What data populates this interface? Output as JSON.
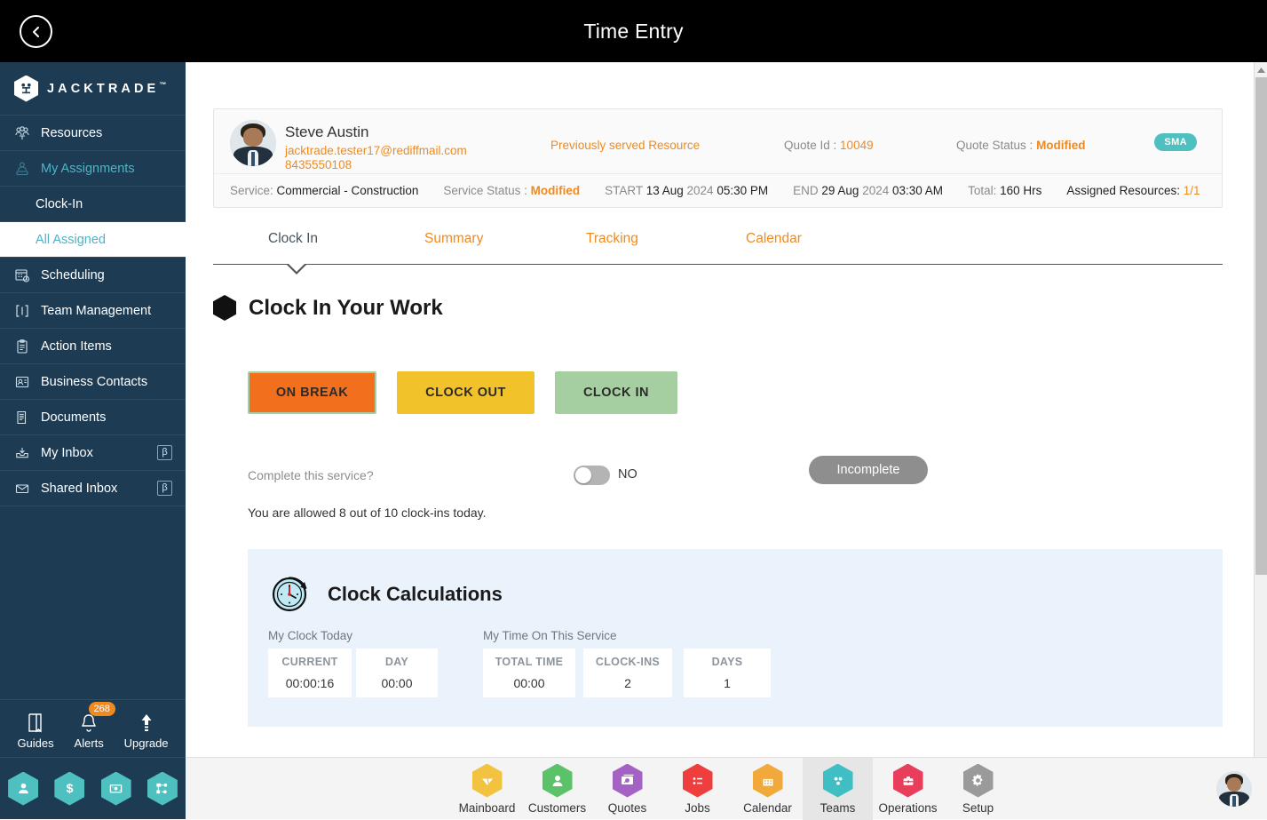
{
  "topbar": {
    "title": "Time Entry",
    "back_icon": "chevron-left-icon"
  },
  "sidebar": {
    "brand": "JACKTRADE",
    "brand_tm": "™",
    "items": [
      {
        "label": "Resources",
        "icon": "people-group-icon",
        "accent": false,
        "sub": false,
        "beta": null
      },
      {
        "label": "My Assignments",
        "icon": "assignment-person-icon",
        "accent": true,
        "sub": false,
        "beta": null
      },
      {
        "label": "Clock-In",
        "icon": null,
        "accent": false,
        "sub": true,
        "beta": null
      },
      {
        "label": "All Assigned",
        "icon": null,
        "accent": true,
        "sub": true,
        "active": true,
        "beta": null
      },
      {
        "label": "Scheduling",
        "icon": "calendar-clock-icon",
        "accent": false,
        "sub": false,
        "beta": null
      },
      {
        "label": "Team Management",
        "icon": "brackets-icon",
        "accent": false,
        "sub": false,
        "beta": null
      },
      {
        "label": "Action Items",
        "icon": "clipboard-list-icon",
        "accent": false,
        "sub": false,
        "beta": null
      },
      {
        "label": "Business Contacts",
        "icon": "contact-card-icon",
        "accent": false,
        "sub": false,
        "beta": null
      },
      {
        "label": "Documents",
        "icon": "document-icon",
        "accent": false,
        "sub": false,
        "beta": null
      },
      {
        "label": "My Inbox",
        "icon": "inbox-download-icon",
        "accent": false,
        "sub": false,
        "beta": "β"
      },
      {
        "label": "Shared Inbox",
        "icon": "envelope-icon",
        "accent": false,
        "sub": false,
        "beta": "β"
      }
    ],
    "tools": [
      {
        "label": "Guides",
        "icon": "book-icon",
        "badge": null
      },
      {
        "label": "Alerts",
        "icon": "bell-icon",
        "badge": "268"
      },
      {
        "label": "Upgrade",
        "icon": "arrow-up-icon",
        "badge": null
      }
    ],
    "hex_shortcuts": [
      {
        "icon": "user-icon"
      },
      {
        "icon": "dollar-icon"
      },
      {
        "icon": "money-transfer-icon"
      },
      {
        "icon": "workflow-icon"
      }
    ]
  },
  "info_card": {
    "person_name": "Steve Austin",
    "person_email": "jacktrade.tester17@rediffmail.com",
    "person_phone": "8435550108",
    "previously_served": "Previously served Resource",
    "quote_id_label": "Quote Id : ",
    "quote_id_value": "10049",
    "quote_status_label": "Quote Status : ",
    "quote_status_value": "Modified",
    "sma_badge": "SMA",
    "service_label": "Service:",
    "service_value": "Commercial - Construction",
    "service_status_label": "Service Status :",
    "service_status_value": "Modified",
    "start_label": "START",
    "start_day": "13 Aug",
    "start_year": "2024",
    "start_time": "05:30 PM",
    "end_label": "END",
    "end_day": "29 Aug",
    "end_year": "2024",
    "end_time": "03:30 AM",
    "total_label": "Total:",
    "total_value": "160 Hrs",
    "assigned_label": "Assigned Resources:",
    "assigned_value": "1/1",
    "accent_color": "#f08a1e",
    "badge_color": "#4fc0c0"
  },
  "tabs": [
    {
      "label": "Clock In",
      "active": true
    },
    {
      "label": "Summary",
      "active": false
    },
    {
      "label": "Tracking",
      "active": false
    },
    {
      "label": "Calendar",
      "active": false
    }
  ],
  "section": {
    "title": "Clock In Your Work",
    "bullet_icon": "hexagon-bullet-icon"
  },
  "actions": {
    "on_break": "ON BREAK",
    "clock_out": "CLOCK OUT",
    "clock_in": "CLOCK IN",
    "on_break_color": "#f2701d",
    "clock_out_color": "#f2c22a",
    "clock_in_color": "#a6cfa1"
  },
  "complete": {
    "question": "Complete this service?",
    "toggle_value": "NO",
    "status_pill": "Incomplete",
    "allowance": "You are allowed 8 out of 10 clock-ins today."
  },
  "calculations": {
    "title": "Clock Calculations",
    "icon": "stopwatch-clock-icon",
    "group_today": "My Clock Today",
    "group_service": "My Time On This Service",
    "stats_today": [
      {
        "key": "CURRENT",
        "value": "00:00:16"
      },
      {
        "key": "DAY",
        "value": "00:00"
      }
    ],
    "stats_service": [
      {
        "key": "TOTAL TIME",
        "value": "00:00"
      },
      {
        "key": "CLOCK-INS",
        "value": "2"
      },
      {
        "key": "DAYS",
        "value": "1"
      }
    ],
    "panel_color": "#eaf2fb"
  },
  "bottom_nav": {
    "items": [
      {
        "label": "Mainboard",
        "icon": "mainboard-icon",
        "color": "#f2c340",
        "active": false
      },
      {
        "label": "Customers",
        "icon": "customers-person-icon",
        "color": "#5cc269",
        "active": false
      },
      {
        "label": "Quotes",
        "icon": "quotes-money-icon",
        "color": "#a462c4",
        "active": false
      },
      {
        "label": "Jobs",
        "icon": "jobs-list-icon",
        "color": "#ef3e3e",
        "active": false
      },
      {
        "label": "Calendar",
        "icon": "calendar-icon",
        "color": "#f2a93b",
        "active": false
      },
      {
        "label": "Teams",
        "icon": "teams-dots-icon",
        "color": "#3fbfc4",
        "active": true
      },
      {
        "label": "Operations",
        "icon": "operations-briefcase-icon",
        "color": "#e83e5c",
        "active": false
      },
      {
        "label": "Setup",
        "icon": "gear-icon",
        "color": "#9a9a9a",
        "active": false
      }
    ],
    "avatar": "user-avatar"
  }
}
